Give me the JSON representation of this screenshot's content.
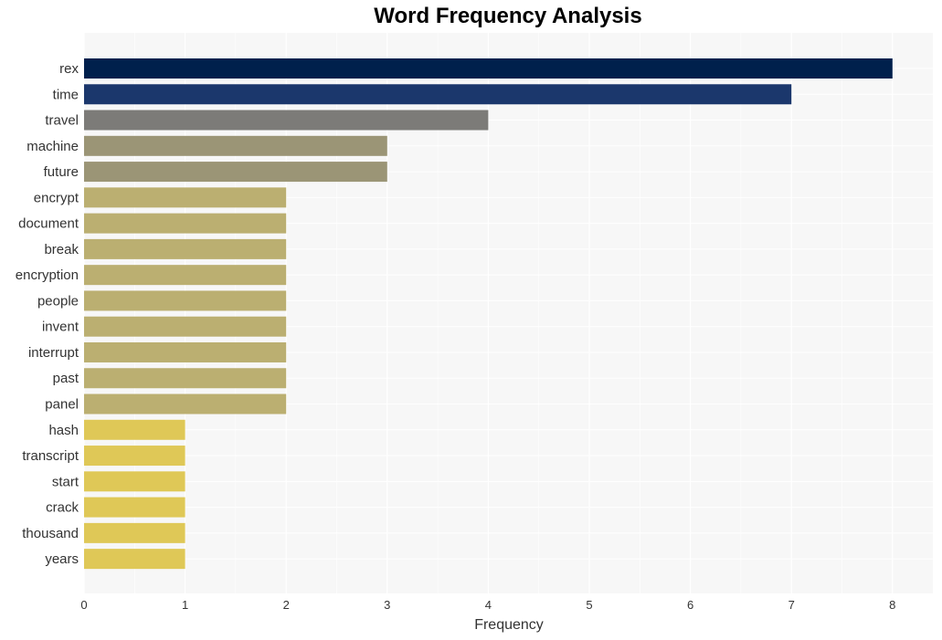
{
  "chart_data": {
    "type": "bar",
    "orientation": "horizontal",
    "title": "Word Frequency Analysis",
    "xlabel": "Frequency",
    "ylabel": "",
    "xlim": [
      0,
      8.4
    ],
    "xticks": [
      0,
      1,
      2,
      3,
      4,
      5,
      6,
      7,
      8
    ],
    "grid": true,
    "categories": [
      "rex",
      "time",
      "travel",
      "machine",
      "future",
      "encrypt",
      "document",
      "break",
      "encryption",
      "people",
      "invent",
      "interrupt",
      "past",
      "panel",
      "hash",
      "transcript",
      "start",
      "crack",
      "thousand",
      "years"
    ],
    "values": [
      8,
      7,
      4,
      3,
      3,
      2,
      2,
      2,
      2,
      2,
      2,
      2,
      2,
      2,
      1,
      1,
      1,
      1,
      1,
      1
    ],
    "colors": [
      "#00204c",
      "#1b376c",
      "#7c7b78",
      "#9b9576",
      "#9b9576",
      "#bbaf71",
      "#bbaf71",
      "#bbaf71",
      "#bbaf71",
      "#bbaf71",
      "#bbaf71",
      "#bbaf71",
      "#bbaf71",
      "#bbaf71",
      "#dfc857",
      "#dfc857",
      "#dfc857",
      "#dfc857",
      "#dfc857",
      "#dfc857"
    ]
  }
}
